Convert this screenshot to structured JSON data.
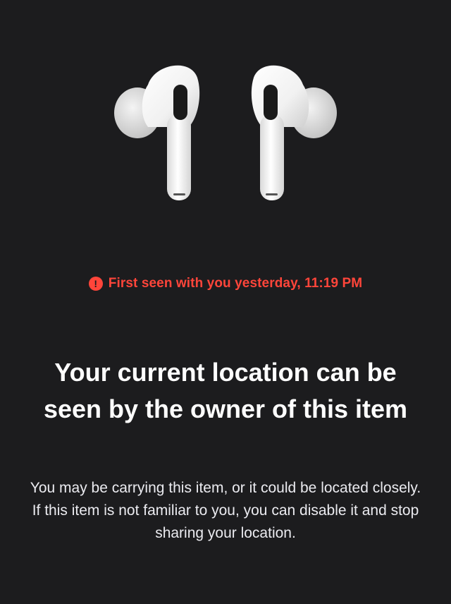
{
  "alert": {
    "icon": "exclamation-circle-icon",
    "text": "First seen with you yesterday, 11:19 PM",
    "color": "#ff453a"
  },
  "heading": {
    "title": "Your current location can be seen by the owner of this item"
  },
  "description": {
    "text": "You may be carrying this item, or it could be located closely. If this item is not familiar to you, you can disable it and stop sharing your location."
  },
  "product": {
    "image": "airpods-pro-image"
  },
  "colors": {
    "background": "#1c1c1e",
    "accent_red": "#ff453a",
    "text": "#ffffff"
  }
}
